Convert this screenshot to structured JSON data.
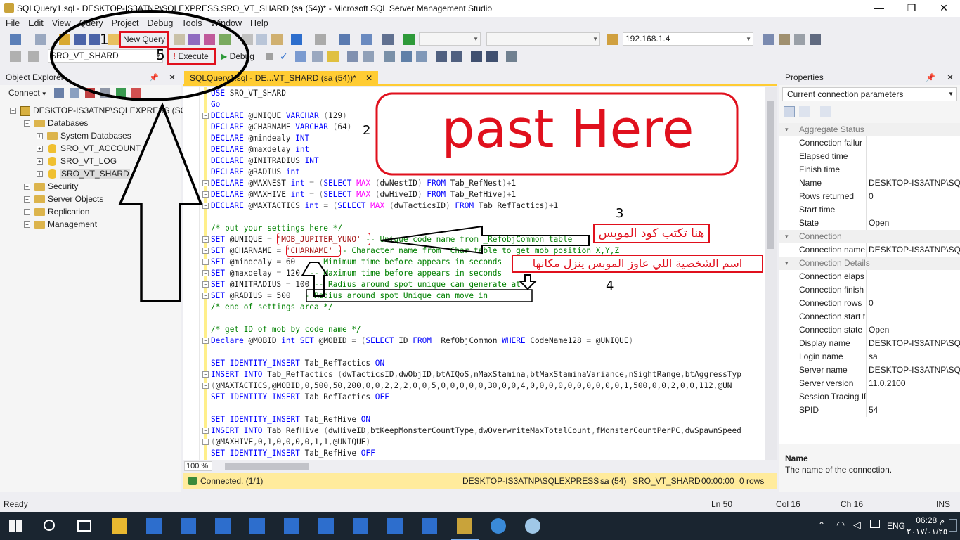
{
  "window": {
    "title": "SQLQuery1.sql - DESKTOP-IS3ATNP\\SQLEXPRESS.SRO_VT_SHARD (sa (54))* - Microsoft SQL Server Management Studio",
    "minimize_glyph": "—",
    "maximize_glyph": "❐",
    "close_glyph": "✕"
  },
  "menu": [
    "File",
    "Edit",
    "View",
    "Query",
    "Project",
    "Debug",
    "Tools",
    "Window",
    "Help"
  ],
  "toolbar": {
    "new_query_label": "New Query",
    "server_address": "192.168.1.4",
    "database": "SRO_VT_SHARD",
    "execute_label": "Execute",
    "debug_label": "Debug"
  },
  "object_explorer": {
    "title": "Object Explorer",
    "connect_label": "Connect",
    "server_node": "DESKTOP-IS3ATNP\\SQLEXPRESS (SQL S",
    "databases_label": "Databases",
    "databases": [
      "System Databases",
      "SRO_VT_ACCOUNT",
      "SRO_VT_LOG",
      "SRO_VT_SHARD"
    ],
    "other_nodes": [
      "Security",
      "Server Objects",
      "Replication",
      "Management"
    ]
  },
  "editor": {
    "tab_title": "SQLQuery1.sql - DE...VT_SHARD (sa (54))*",
    "tab_close": "✕",
    "zoom": "100 %",
    "lines": [
      [
        [
          "k",
          "USE "
        ],
        [
          "v",
          "SRO_VT_SHARD"
        ]
      ],
      [
        [
          "k",
          "Go"
        ]
      ],
      [
        [
          "k",
          "DECLARE "
        ],
        [
          "v",
          "@UNIQUE "
        ],
        [
          "k",
          "VARCHAR "
        ],
        [
          "g",
          "("
        ],
        [
          "v",
          "129"
        ],
        [
          "g",
          ")"
        ]
      ],
      [
        [
          "k",
          "DECLARE "
        ],
        [
          "v",
          "@CHARNAME "
        ],
        [
          "k",
          "VARCHAR "
        ],
        [
          "g",
          "("
        ],
        [
          "v",
          "64"
        ],
        [
          "g",
          ")"
        ]
      ],
      [
        [
          "k",
          "DECLARE "
        ],
        [
          "v",
          "@mindealy "
        ],
        [
          "k",
          "INT"
        ]
      ],
      [
        [
          "k",
          "DECLARE "
        ],
        [
          "v",
          "@maxdelay "
        ],
        [
          "k",
          "int"
        ]
      ],
      [
        [
          "k",
          "DECLARE "
        ],
        [
          "v",
          "@INITRADIUS "
        ],
        [
          "k",
          "INT"
        ]
      ],
      [
        [
          "k",
          "DECLARE "
        ],
        [
          "v",
          "@RADIUS "
        ],
        [
          "k",
          "int"
        ]
      ],
      [
        [
          "k",
          "DECLARE "
        ],
        [
          "v",
          "@MAXNEST "
        ],
        [
          "k",
          "int "
        ],
        [
          "g",
          "= ("
        ],
        [
          "k",
          "SELECT "
        ],
        [
          "f",
          "MAX "
        ],
        [
          "g",
          "("
        ],
        [
          "v",
          "dwNestID"
        ],
        [
          "g",
          ") "
        ],
        [
          "k",
          "FROM "
        ],
        [
          "v",
          "Tab_RefNest"
        ],
        [
          "g",
          ")+"
        ],
        [
          "v",
          "1"
        ]
      ],
      [
        [
          "k",
          "DECLARE "
        ],
        [
          "v",
          "@MAXHIVE "
        ],
        [
          "k",
          "int "
        ],
        [
          "g",
          "= ("
        ],
        [
          "k",
          "SELECT "
        ],
        [
          "f",
          "MAX "
        ],
        [
          "g",
          "("
        ],
        [
          "v",
          "dwHiveID"
        ],
        [
          "g",
          ") "
        ],
        [
          "k",
          "FROM "
        ],
        [
          "v",
          "Tab_RefHive"
        ],
        [
          "g",
          ")+"
        ],
        [
          "v",
          "1"
        ]
      ],
      [
        [
          "k",
          "DECLARE "
        ],
        [
          "v",
          "@MAXTACTICS "
        ],
        [
          "k",
          "int "
        ],
        [
          "g",
          "= ("
        ],
        [
          "k",
          "SELECT "
        ],
        [
          "f",
          "MAX "
        ],
        [
          "g",
          "("
        ],
        [
          "v",
          "dwTacticsID"
        ],
        [
          "g",
          ") "
        ],
        [
          "k",
          "FROM "
        ],
        [
          "v",
          "Tab_RefTactics"
        ],
        [
          "g",
          ")+"
        ],
        [
          "v",
          "1"
        ]
      ],
      [],
      [
        [
          "c",
          "/* put your settings here */"
        ]
      ],
      [
        [
          "k",
          "SET "
        ],
        [
          "v",
          "@UNIQUE "
        ],
        [
          "g",
          "= "
        ],
        [
          "s",
          "'MOB_JUPITER_YUNO'"
        ],
        [
          "c",
          " -- Unique code name from _RefobjCommon table"
        ]
      ],
      [
        [
          "k",
          "SET "
        ],
        [
          "v",
          "@CHARNAME "
        ],
        [
          "g",
          "= "
        ],
        [
          "s",
          "'CHARNAME'"
        ],
        [
          "c",
          " -- Character name from _Char table to get mob position X,Y,Z"
        ]
      ],
      [
        [
          "k",
          "SET "
        ],
        [
          "v",
          "@mindealy "
        ],
        [
          "g",
          "= "
        ],
        [
          "v",
          "60   "
        ],
        [
          "c",
          "-- Minimum time before appears in seconds"
        ]
      ],
      [
        [
          "k",
          "SET "
        ],
        [
          "v",
          "@maxdelay "
        ],
        [
          "g",
          "= "
        ],
        [
          "v",
          "120  "
        ],
        [
          "c",
          "-- Maximum time before appears in seconds"
        ]
      ],
      [
        [
          "k",
          "SET "
        ],
        [
          "v",
          "@INITRADIUS "
        ],
        [
          "g",
          "= "
        ],
        [
          "v",
          "100 "
        ],
        [
          "c",
          "-- Radius around spot unique can generate at"
        ]
      ],
      [
        [
          "k",
          "SET "
        ],
        [
          "v",
          "@RADIUS "
        ],
        [
          "g",
          "= "
        ],
        [
          "v",
          "500   "
        ],
        [
          "c",
          "- Radius around spot Unique can move in"
        ]
      ],
      [
        [
          "c",
          "/* end of settings area */"
        ]
      ],
      [],
      [
        [
          "c",
          "/* get ID of mob by code name */"
        ]
      ],
      [
        [
          "k",
          "Declare "
        ],
        [
          "v",
          "@MOBID "
        ],
        [
          "k",
          "int SET "
        ],
        [
          "v",
          "@MOBID "
        ],
        [
          "g",
          "= ("
        ],
        [
          "k",
          "SELECT "
        ],
        [
          "v",
          "ID "
        ],
        [
          "k",
          "FROM "
        ],
        [
          "v",
          "_RefObjCommon "
        ],
        [
          "k",
          "WHERE "
        ],
        [
          "v",
          "CodeName128 "
        ],
        [
          "g",
          "= "
        ],
        [
          "v",
          "@UNIQUE"
        ],
        [
          "g",
          ")"
        ]
      ],
      [],
      [
        [
          "k",
          "SET IDENTITY_INSERT "
        ],
        [
          "v",
          "Tab_RefTactics "
        ],
        [
          "k",
          "ON"
        ]
      ],
      [
        [
          "k",
          "INSERT INTO "
        ],
        [
          "v",
          "Tab_RefTactics "
        ],
        [
          "g",
          "("
        ],
        [
          "v",
          "dwTacticsID"
        ],
        [
          "g",
          ","
        ],
        [
          "v",
          "dwObjID"
        ],
        [
          "g",
          ","
        ],
        [
          "v",
          "btAIQoS"
        ],
        [
          "g",
          ","
        ],
        [
          "v",
          "nMaxStamina"
        ],
        [
          "g",
          ","
        ],
        [
          "v",
          "btMaxStaminaVariance"
        ],
        [
          "g",
          ","
        ],
        [
          "v",
          "nSightRange"
        ],
        [
          "g",
          ","
        ],
        [
          "v",
          "btAggressTyp"
        ]
      ],
      [
        [
          "g",
          "("
        ],
        [
          "v",
          "@MAXTACTICS"
        ],
        [
          "g",
          ","
        ],
        [
          "v",
          "@MOBID"
        ],
        [
          "g",
          ","
        ],
        [
          "v",
          "0,500,50,200,0,0,2,2,2,0,0,5,0,0,0,0,0,30,0,0,4,0,0,0,0,0,0,0,0,0,0,1,500,0,0,2,0,0,112"
        ],
        [
          "g",
          ","
        ],
        [
          "v",
          "@UN"
        ]
      ],
      [
        [
          "k",
          "SET IDENTITY_INSERT "
        ],
        [
          "v",
          "Tab_RefTactics "
        ],
        [
          "k",
          "OFF"
        ]
      ],
      [],
      [
        [
          "k",
          "SET IDENTITY_INSERT "
        ],
        [
          "v",
          "Tab_RefHive "
        ],
        [
          "k",
          "ON"
        ]
      ],
      [
        [
          "k",
          "INSERT INTO "
        ],
        [
          "v",
          "Tab_RefHive "
        ],
        [
          "g",
          "("
        ],
        [
          "v",
          "dwHiveID"
        ],
        [
          "g",
          ","
        ],
        [
          "v",
          "btKeepMonsterCountType"
        ],
        [
          "g",
          ","
        ],
        [
          "v",
          "dwOverwriteMaxTotalCount"
        ],
        [
          "g",
          ","
        ],
        [
          "v",
          "fMonsterCountPerPC"
        ],
        [
          "g",
          ","
        ],
        [
          "v",
          "dwSpawnSpeed"
        ]
      ],
      [
        [
          "g",
          "("
        ],
        [
          "v",
          "@MAXHIVE"
        ],
        [
          "g",
          ","
        ],
        [
          "v",
          "0,1,0,0,0,0,1,1"
        ],
        [
          "g",
          ","
        ],
        [
          "v",
          "@UNIQUE"
        ],
        [
          "g",
          ")"
        ]
      ],
      [
        [
          "k",
          "SET IDENTITY_INSERT "
        ],
        [
          "v",
          "Tab_RefHive "
        ],
        [
          "k",
          "OFF"
        ]
      ]
    ]
  },
  "query_status": {
    "message": "Connected. (1/1)",
    "server": "DESKTOP-IS3ATNP\\SQLEXPRESS ...",
    "user": "sa (54)",
    "database": "SRO_VT_SHARD",
    "time": "00:00:00",
    "rows": "0 rows"
  },
  "properties": {
    "title": "Properties",
    "selector": "Current connection parameters",
    "rows": [
      {
        "cat": true,
        "name": "Aggregate Status"
      },
      {
        "name": "Connection failur",
        "value": ""
      },
      {
        "name": "Elapsed time",
        "value": ""
      },
      {
        "name": "Finish time",
        "value": ""
      },
      {
        "name": "Name",
        "value": "DESKTOP-IS3ATNP\\SQL"
      },
      {
        "name": "Rows returned",
        "value": "0"
      },
      {
        "name": "Start time",
        "value": ""
      },
      {
        "name": "State",
        "value": "Open"
      },
      {
        "cat": true,
        "name": "Connection"
      },
      {
        "name": "Connection name",
        "value": "DESKTOP-IS3ATNP\\SQL"
      },
      {
        "cat": true,
        "name": "Connection Details"
      },
      {
        "name": "Connection elaps",
        "value": ""
      },
      {
        "name": "Connection finish",
        "value": ""
      },
      {
        "name": "Connection rows",
        "value": "0"
      },
      {
        "name": "Connection start t",
        "value": ""
      },
      {
        "name": "Connection state",
        "value": "Open"
      },
      {
        "name": "Display name",
        "value": "DESKTOP-IS3ATNP\\SQL"
      },
      {
        "name": "Login name",
        "value": "sa"
      },
      {
        "name": "Server name",
        "value": "DESKTOP-IS3ATNP\\SQL"
      },
      {
        "name": "Server version",
        "value": "11.0.2100"
      },
      {
        "name": "Session Tracing ID",
        "value": ""
      },
      {
        "name": "SPID",
        "value": "54"
      }
    ],
    "desc_title": "Name",
    "desc_text": "The name of the connection."
  },
  "status_bar": {
    "state": "Ready",
    "ln": "Ln 50",
    "col": "Col 16",
    "ch": "Ch 16",
    "ins": "INS"
  },
  "taskbar": {
    "time": "06:28 م",
    "date": "٢٠١٧/٠١/٢٥",
    "language": "ENG"
  },
  "annotations": {
    "n1": "1",
    "n2": "2",
    "n3": "3",
    "n4": "4",
    "n5": "5",
    "paste_here": "past Here",
    "arabic_mob_code": "هنا تكتب كود الموبس",
    "arabic_char_name": "اسم الشخصية اللي عاوز الموبس ينزل مكانها"
  },
  "colors": {
    "accent_tab": "#ffcc33",
    "annotation_red": "#e0101d",
    "keyword": "#0000ff",
    "string": "#a31515",
    "comment": "#008000"
  }
}
